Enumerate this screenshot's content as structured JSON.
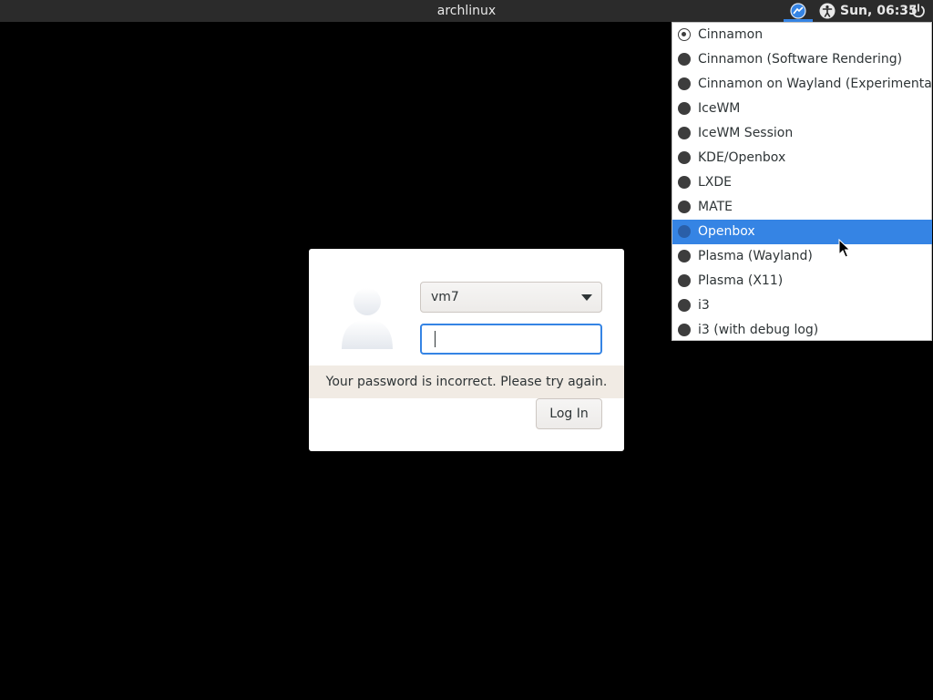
{
  "topbar": {
    "hostname": "archlinux",
    "clock": "Sun, 06:35",
    "session_icon": "session-icon",
    "accessibility_icon": "accessibility-icon",
    "power_icon": "power-icon"
  },
  "session_menu": {
    "selected": "Cinnamon",
    "highlighted": "Openbox",
    "items": [
      {
        "label": "Cinnamon"
      },
      {
        "label": "Cinnamon (Software Rendering)"
      },
      {
        "label": "Cinnamon on Wayland (Experimental)"
      },
      {
        "label": "IceWM"
      },
      {
        "label": "IceWM Session"
      },
      {
        "label": "KDE/Openbox"
      },
      {
        "label": "LXDE"
      },
      {
        "label": "MATE"
      },
      {
        "label": "Openbox"
      },
      {
        "label": "Plasma (Wayland)"
      },
      {
        "label": "Plasma (X11)"
      },
      {
        "label": "i3"
      },
      {
        "label": "i3 (with debug log)"
      }
    ]
  },
  "login": {
    "username": "vm7",
    "password_value": "",
    "error_message": "Your password is incorrect. Please try again.",
    "login_label": "Log In",
    "avatar_icon": "user-avatar-icon"
  },
  "colors": {
    "accent": "#3584e4",
    "topbar_bg": "#2b2b2b",
    "error_bg": "#f1ebe4",
    "background": "#000000"
  }
}
